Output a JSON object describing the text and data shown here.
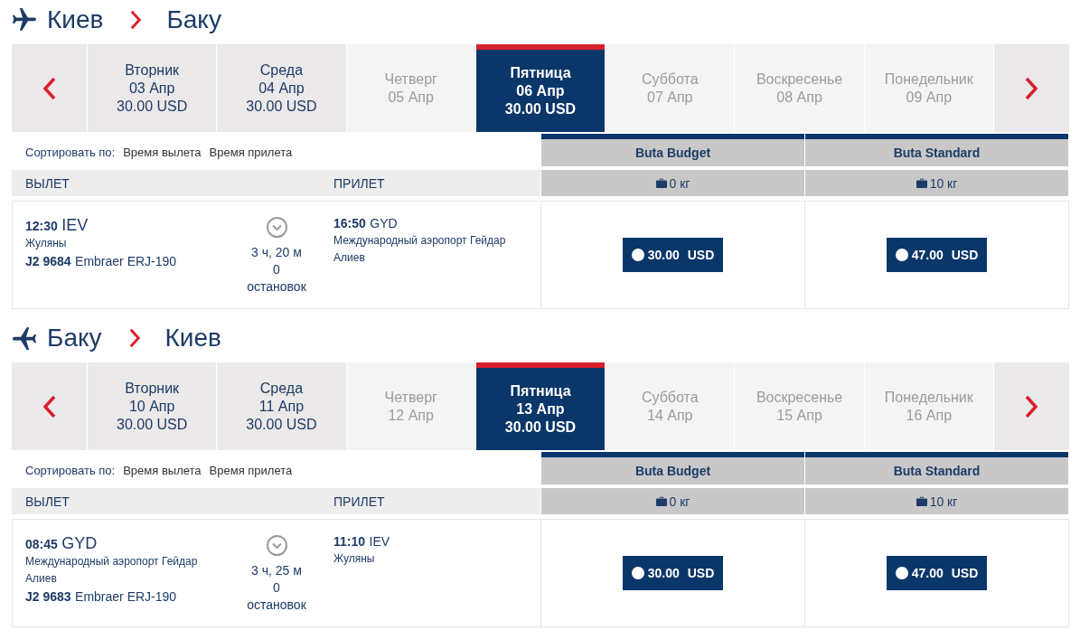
{
  "legs": [
    {
      "kind": "outbound",
      "from": "Киев",
      "to": "Баку",
      "days": [
        {
          "weekday": "Вторник",
          "date": "03 Апр",
          "price": "30.00 USD",
          "selected": false,
          "disabled": false
        },
        {
          "weekday": "Среда",
          "date": "04 Апр",
          "price": "30.00 USD",
          "selected": false,
          "disabled": false
        },
        {
          "weekday": "Четверг",
          "date": "05 Апр",
          "selected": false,
          "disabled": true
        },
        {
          "weekday": "Пятница",
          "date": "06 Апр",
          "price": "30.00 USD",
          "selected": true,
          "disabled": false
        },
        {
          "weekday": "Суббота",
          "date": "07 Апр",
          "selected": false,
          "disabled": true
        },
        {
          "weekday": "Воскресенье",
          "date": "08 Апр",
          "selected": false,
          "disabled": true
        },
        {
          "weekday": "Понедельник",
          "date": "09 Апр",
          "selected": false,
          "disabled": true
        }
      ],
      "sort": {
        "label": "Сортировать по:",
        "options": [
          "Время вылета",
          "Время прилета"
        ]
      },
      "columns": {
        "departure": "ВЫЛЕТ",
        "arrival": "ПРИЛЕТ"
      },
      "fares": [
        {
          "name": "Buta Budget",
          "baggage": "0 кг"
        },
        {
          "name": "Buta Standard",
          "baggage": "10 кг"
        }
      ],
      "flights": [
        {
          "departure": {
            "time": "12:30",
            "code": "IEV",
            "airport": "Жуляны"
          },
          "flight_number": "J2 9684",
          "aircraft": "Embraer ERJ-190",
          "duration": "3 ч, 20 м",
          "stops": "0",
          "stops_label": "остановок",
          "arrival": {
            "time": "16:50",
            "code": "GYD",
            "airport": "Международный аэропорт Гейдар Алиев"
          },
          "prices": [
            {
              "amount": "30.00",
              "currency": "USD",
              "selected": false
            },
            {
              "amount": "47.00",
              "currency": "USD",
              "selected": false
            }
          ]
        }
      ]
    },
    {
      "kind": "return",
      "from": "Баку",
      "to": "Киев",
      "days": [
        {
          "weekday": "Вторник",
          "date": "10 Апр",
          "price": "30.00 USD",
          "selected": false,
          "disabled": false
        },
        {
          "weekday": "Среда",
          "date": "11 Апр",
          "price": "30.00 USD",
          "selected": false,
          "disabled": false
        },
        {
          "weekday": "Четверг",
          "date": "12 Апр",
          "selected": false,
          "disabled": true
        },
        {
          "weekday": "Пятница",
          "date": "13 Апр",
          "price": "30.00 USD",
          "selected": true,
          "disabled": false
        },
        {
          "weekday": "Суббота",
          "date": "14 Апр",
          "selected": false,
          "disabled": true
        },
        {
          "weekday": "Воскресенье",
          "date": "15 Апр",
          "selected": false,
          "disabled": true
        },
        {
          "weekday": "Понедельник",
          "date": "16 Апр",
          "selected": false,
          "disabled": true
        }
      ],
      "sort": {
        "label": "Сортировать по:",
        "options": [
          "Время вылета",
          "Время прилета"
        ]
      },
      "columns": {
        "departure": "ВЫЛЕТ",
        "arrival": "ПРИЛЕТ"
      },
      "fares": [
        {
          "name": "Buta Budget",
          "baggage": "0 кг"
        },
        {
          "name": "Buta Standard",
          "baggage": "10 кг"
        }
      ],
      "flights": [
        {
          "departure": {
            "time": "08:45",
            "code": "GYD",
            "airport": "Международный аэропорт Гейдар Алиев"
          },
          "flight_number": "J2 9683",
          "aircraft": "Embraer ERJ-190",
          "duration": "3 ч, 25 м",
          "stops": "0",
          "stops_label": "остановок",
          "arrival": {
            "time": "11:10",
            "code": "IEV",
            "airport": "Жуляны"
          },
          "prices": [
            {
              "amount": "30.00",
              "currency": "USD",
              "selected": false
            },
            {
              "amount": "47.00",
              "currency": "USD",
              "selected": false
            }
          ]
        }
      ]
    }
  ]
}
